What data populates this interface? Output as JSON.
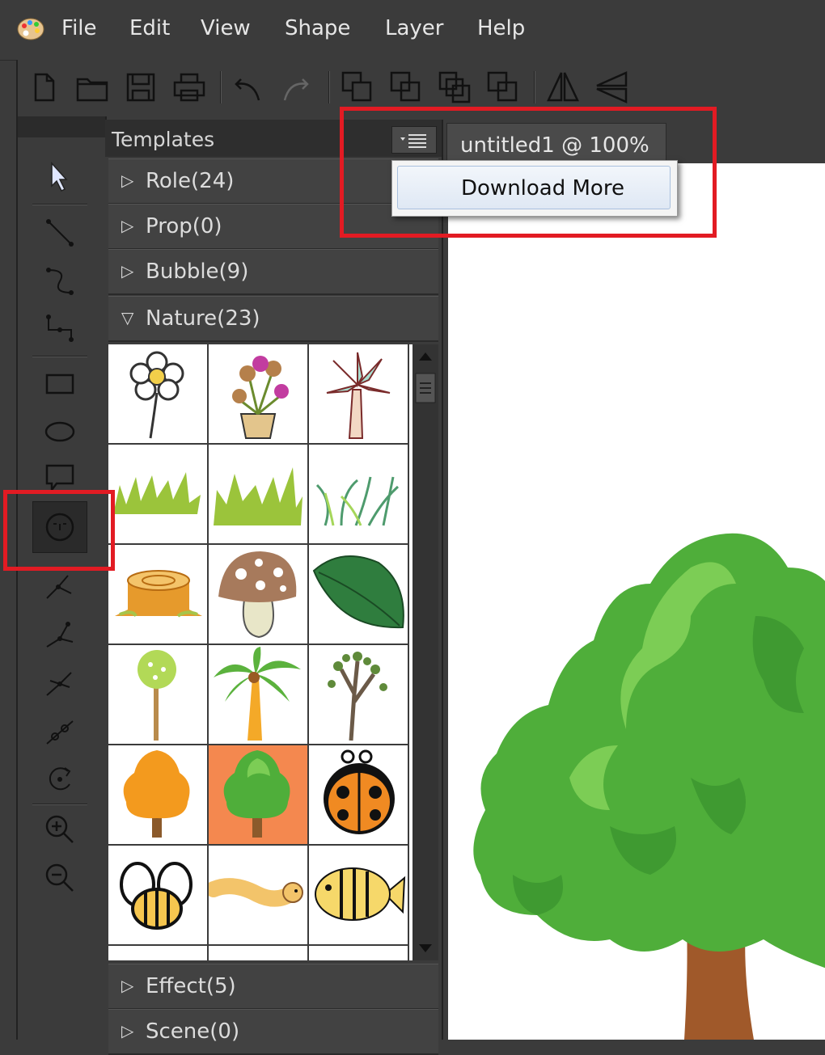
{
  "menubar": {
    "items": [
      "File",
      "Edit",
      "View",
      "Shape",
      "Layer",
      "Help"
    ]
  },
  "panel": {
    "title": "Templates",
    "categories": [
      {
        "label": "Role(24)",
        "expanded": false
      },
      {
        "label": "Prop(0)",
        "expanded": false
      },
      {
        "label": "Bubble(9)",
        "expanded": false
      },
      {
        "label": "Nature(23)",
        "expanded": true
      },
      {
        "label": "Effect(5)",
        "expanded": false
      },
      {
        "label": "Scene(0)",
        "expanded": false
      }
    ],
    "menu": {
      "download_more": "Download More"
    }
  },
  "document": {
    "tab_title": "untitled1 @ 100%"
  },
  "toolbar": {
    "icons": [
      "new-file-icon",
      "open-folder-icon",
      "save-icon",
      "print-icon",
      "undo-icon",
      "redo-icon",
      "bring-front-icon",
      "bring-forward-icon",
      "send-backward-icon",
      "send-back-icon",
      "flip-horizontal-icon",
      "flip-vertical-icon"
    ]
  },
  "colors": {
    "highlight": "#e21b23",
    "selected_cell": "#f4884f",
    "tree_green": "#4fae3a"
  }
}
